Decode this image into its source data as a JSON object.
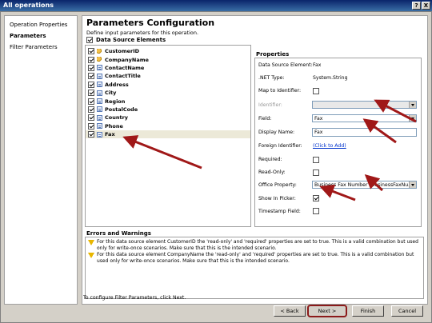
{
  "window": {
    "title": "All operations",
    "help_glyph": "?",
    "close_glyph": "X"
  },
  "nav": {
    "items": [
      {
        "label": "Operation Properties",
        "active": false
      },
      {
        "label": "Parameters",
        "active": true
      },
      {
        "label": "Filter Parameters",
        "active": false
      }
    ]
  },
  "header": {
    "title": "Parameters Configuration",
    "description": "Define input parameters for this operation."
  },
  "data_source": {
    "header": "Data Source Elements",
    "items": [
      {
        "label": "CustomerID",
        "icon": "key-icon"
      },
      {
        "label": "CompanyName",
        "icon": "key-icon"
      },
      {
        "label": "ContactName",
        "icon": "field-icon"
      },
      {
        "label": "ContactTitle",
        "icon": "field-icon"
      },
      {
        "label": "Address",
        "icon": "field-icon"
      },
      {
        "label": "City",
        "icon": "field-icon"
      },
      {
        "label": "Region",
        "icon": "field-icon"
      },
      {
        "label": "PostalCode",
        "icon": "field-icon"
      },
      {
        "label": "Country",
        "icon": "field-icon"
      },
      {
        "label": "Phone",
        "icon": "field-icon"
      },
      {
        "label": "Fax",
        "icon": "field-icon"
      }
    ]
  },
  "properties": {
    "header": "Properties",
    "data_source_element_label": "Data Source Element:",
    "data_source_element_value": "Fax",
    "net_type_label": ".NET Type:",
    "net_type_value": "System.String",
    "map_to_identifier_label": "Map to Identifier:",
    "identifier_label": "Identifier:",
    "field_label": "Field:",
    "field_value": "Fax",
    "display_name_label": "Display Name:",
    "display_name_value": "Fax",
    "foreign_identifier_label": "Foreign Identifier:",
    "foreign_identifier_link": "(Click to Add)",
    "required_label": "Required:",
    "read_only_label": "Read-Only:",
    "office_property_label": "Office Property:",
    "office_property_value": "Business Fax Number (BusinessFaxNu...",
    "show_in_picker_label": "Show In Picker:",
    "timestamp_field_label": "Timestamp Field:"
  },
  "errors": {
    "header": "Errors and Warnings",
    "items": [
      "For this data source element CustomerID the 'read-only' and 'required' properties are set to true. This is a valid combination but used only for write-once scenarios. Make sure that this is the intended scenario.",
      "For this data source element CompanyName the 'read-only' and 'required' properties are set to true. This is a valid combination but used only for write-once scenarios. Make sure that this is the intended scenario."
    ]
  },
  "footer": {
    "note": "To configure Filter Parameters, click Next.",
    "back": "< Back",
    "next": "Next >",
    "finish": "Finish",
    "cancel": "Cancel"
  },
  "colors": {
    "annotation_arrow": "#a01818",
    "title_bar": "#0a246a"
  }
}
